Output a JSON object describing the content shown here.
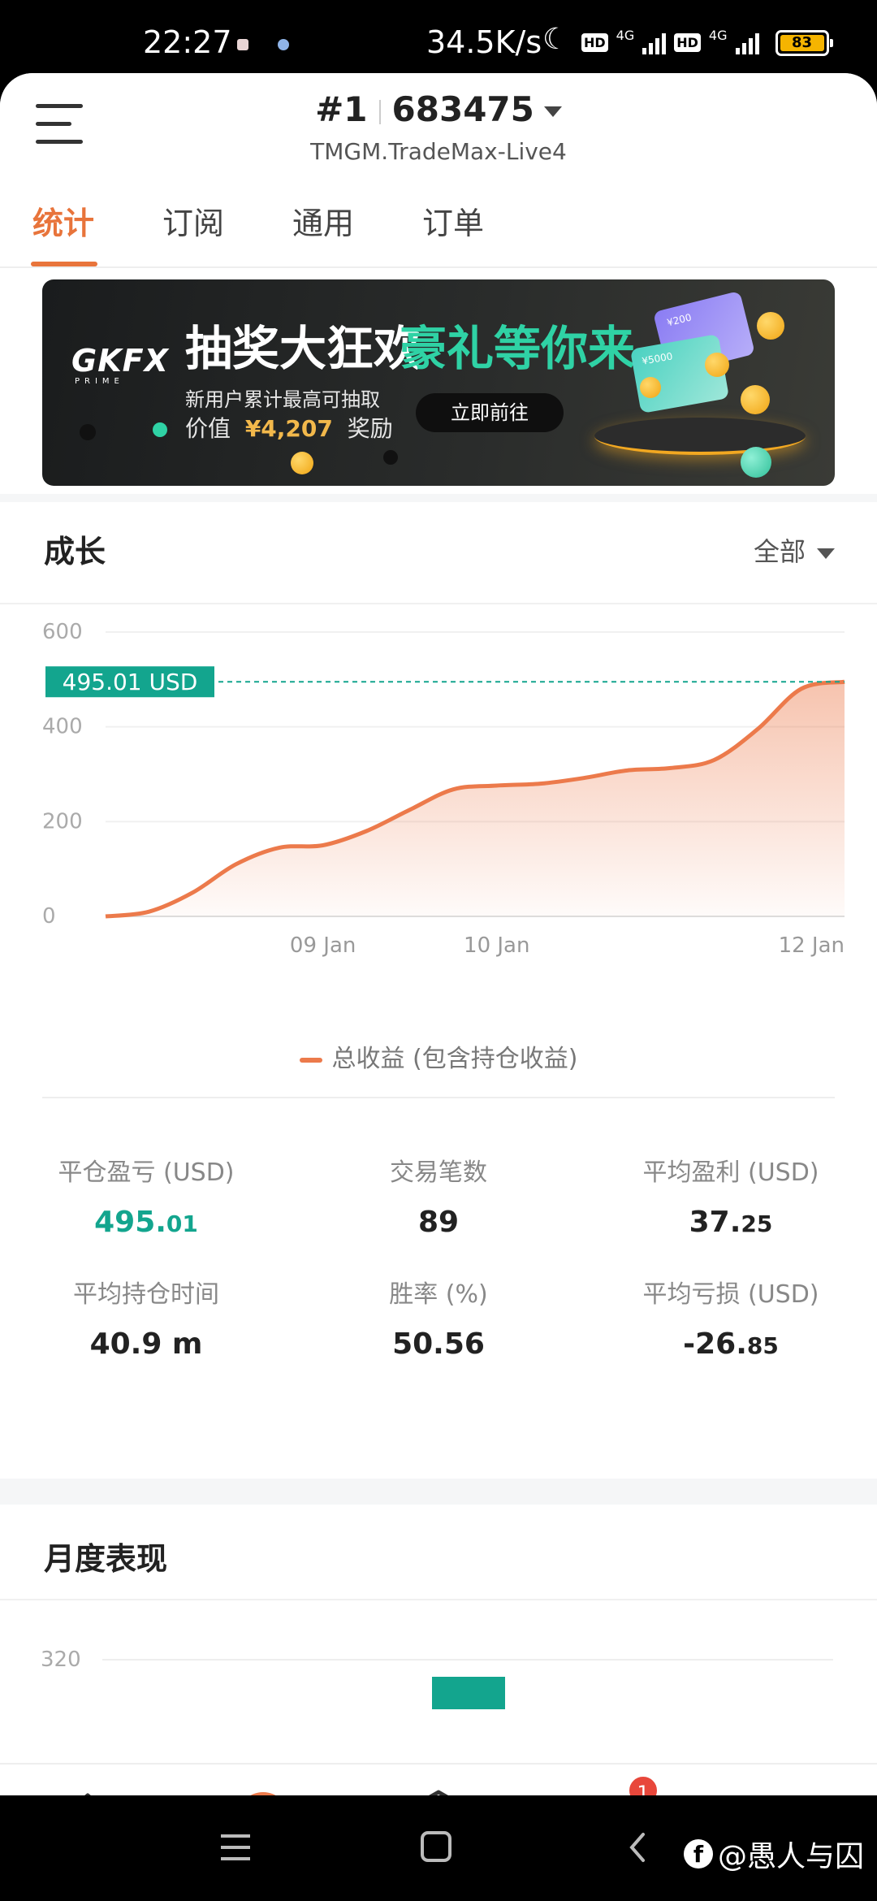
{
  "status_bar": {
    "time": "22:27",
    "net_speed": "34.5K/s",
    "hd": "HD",
    "network": "4G",
    "battery": "83"
  },
  "header": {
    "account_index": "#1",
    "account_number": "683475",
    "server": "TMGM.TradeMax-Live4"
  },
  "tabs": [
    {
      "label": "统计",
      "active": true
    },
    {
      "label": "订阅",
      "active": false
    },
    {
      "label": "通用",
      "active": false
    },
    {
      "label": "订单",
      "active": false
    }
  ],
  "banner": {
    "logo": "GKFX",
    "logo_sub": "PRIME",
    "title": "抽奖大狂欢",
    "title_accent": "豪礼等你来",
    "line1": "新用户累计最高可抽取",
    "line2_prefix": "价值",
    "line2_amount": "¥4,207",
    "line2_suffix": "奖励",
    "button": "立即前往",
    "card1": "¥200",
    "card2": "¥5000"
  },
  "growth": {
    "title": "成长",
    "filter": "全部",
    "legend": "总收益 (包含持仓收益)"
  },
  "chart_data": {
    "type": "area",
    "series": [
      {
        "name": "总收益 (包含持仓收益)",
        "values": [
          0,
          10,
          50,
          110,
          145,
          150,
          180,
          225,
          268,
          276,
          280,
          292,
          308,
          313,
          330,
          395,
          480,
          495.01
        ]
      }
    ],
    "x_ticks": [
      "09 Jan",
      "10 Jan",
      "12 Jan"
    ],
    "y_ticks": [
      "0",
      "200",
      "400",
      "600"
    ],
    "ylim": [
      0,
      600
    ],
    "current_label": "495.01 USD",
    "current_value": 495.01,
    "line_color": "#ec7a4b",
    "label_color": "#13a58e"
  },
  "stats": {
    "closed_pnl": {
      "label": "平仓盈亏 (USD)",
      "int": "495.",
      "dec": "01"
    },
    "trades": {
      "label": "交易笔数",
      "value": "89"
    },
    "avg_profit": {
      "label": "平均盈利 (USD)",
      "int": "37.",
      "dec": "25"
    },
    "avg_hold": {
      "label": "平均持仓时间",
      "value": "40.9 m"
    },
    "win_rate": {
      "label": "胜率 (%)",
      "value": "50.56"
    },
    "avg_loss": {
      "label": "平均亏损 (USD)",
      "int": "-26.",
      "dec": "85"
    }
  },
  "monthly": {
    "title": "月度表现",
    "y_tick": "320"
  },
  "bottom_nav": {
    "badge_count": "1",
    "items": [
      "home-icon",
      "feed-icon",
      "trade-icon",
      "messages-icon",
      "profile-card-icon"
    ]
  },
  "watermark": "@愚人与囚",
  "colors": {
    "accent": "#e8743b",
    "green": "#13a58e"
  }
}
